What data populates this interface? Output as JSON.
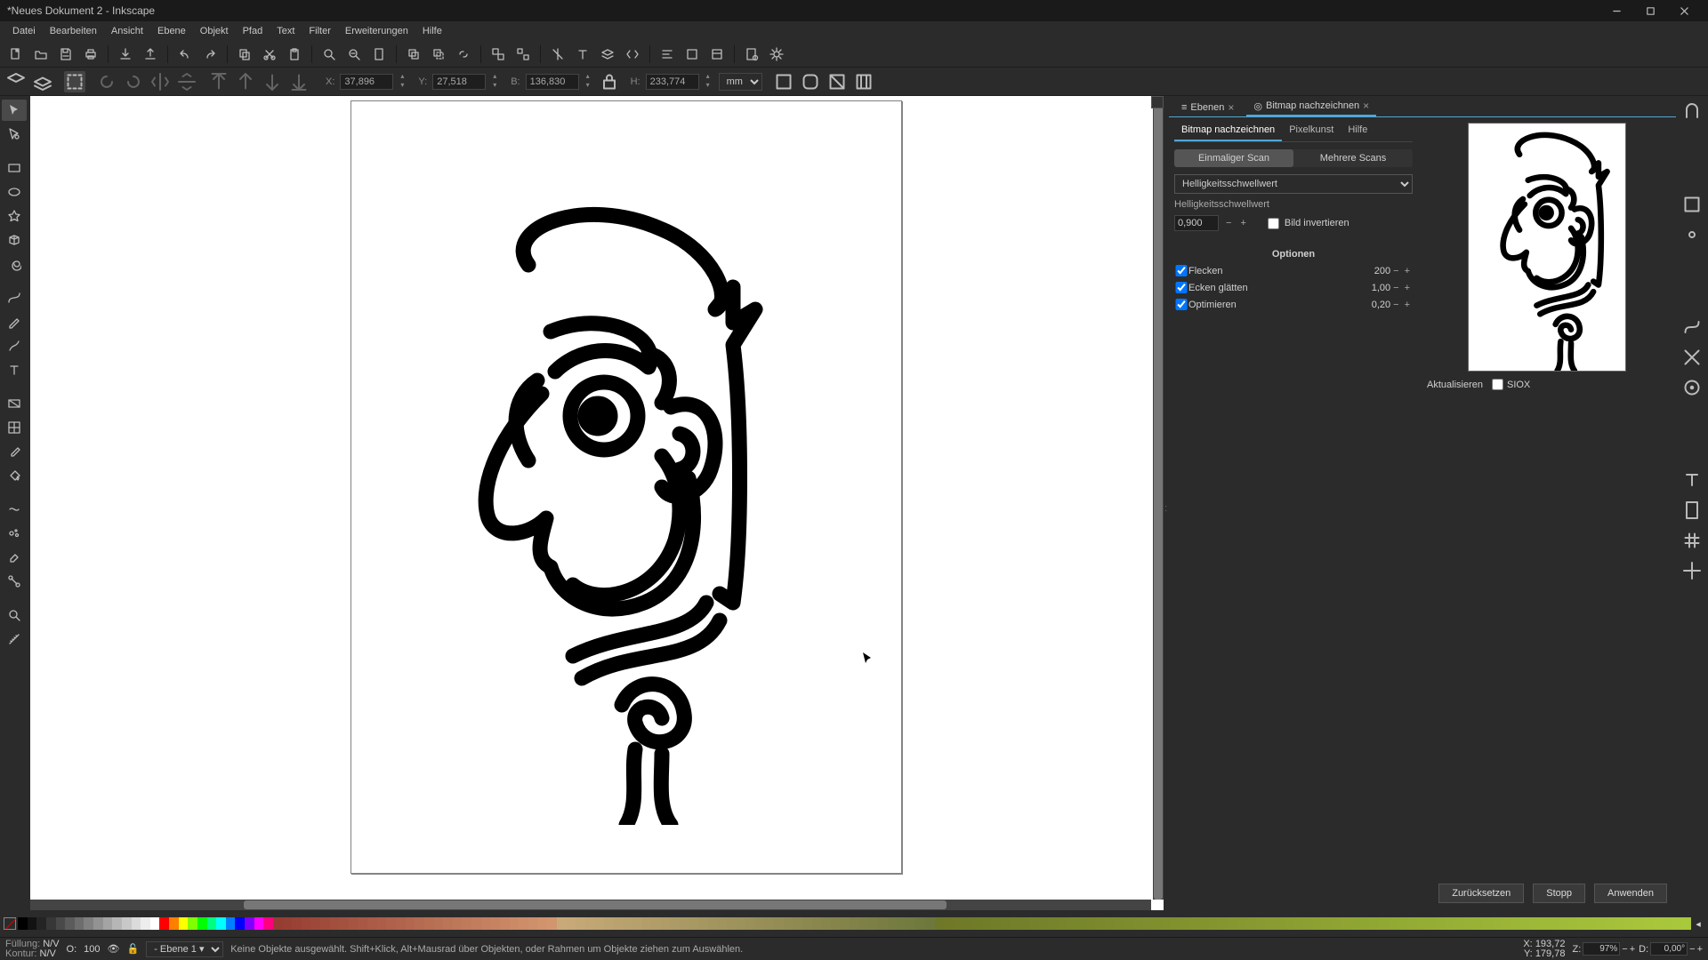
{
  "window": {
    "title": "*Neues Dokument 2 - Inkscape"
  },
  "menu": [
    "Datei",
    "Bearbeiten",
    "Ansicht",
    "Ebene",
    "Objekt",
    "Pfad",
    "Text",
    "Filter",
    "Erweiterungen",
    "Hilfe"
  ],
  "tool_options": {
    "x_label": "X:",
    "x_val": "37,896",
    "y_label": "Y:",
    "y_val": "27,518",
    "w_label": "B:",
    "w_val": "136,830",
    "h_label": "H:",
    "h_val": "233,774",
    "unit": "mm"
  },
  "panel": {
    "tab_layers": "Ebenen",
    "tab_trace": "Bitmap nachzeichnen",
    "subtab_trace": "Bitmap nachzeichnen",
    "subtab_pixel": "Pixelkunst",
    "subtab_help": "Hilfe",
    "mode_single": "Einmaliger Scan",
    "mode_multi": "Mehrere Scans",
    "method": "Helligkeitsschwellwert",
    "threshold_label": "Helligkeitsschwellwert",
    "threshold_val": "0,900",
    "invert_label": "Bild invertieren",
    "options_title": "Optionen",
    "opt_speckles_label": "Flecken",
    "opt_speckles_val": "200",
    "opt_corners_label": "Ecken glätten",
    "opt_corners_val": "1,00",
    "opt_optimize_label": "Optimieren",
    "opt_optimize_val": "0,20",
    "update": "Aktualisieren",
    "siox": "SIOX",
    "btn_reset": "Zurücksetzen",
    "btn_stop": "Stopp",
    "btn_apply": "Anwenden"
  },
  "status": {
    "fill_label": "Füllung:",
    "fill_val": "N/V",
    "stroke_label": "Kontur:",
    "stroke_val": "N/V",
    "opacity_label": "O:",
    "opacity_val": "100",
    "layer": "Ebene 1",
    "hint": "Keine Objekte ausgewählt. Shift+Klick, Alt+Mausrad über Objekten, oder Rahmen um Objekte ziehen zum Auswählen.",
    "cursor_x_label": "X:",
    "cursor_x": "193,72",
    "cursor_y_label": "Y:",
    "cursor_y": "179,78",
    "zoom_label": "Z:",
    "zoom": "97%",
    "rot_label": "D:",
    "rot": "0,00°"
  }
}
